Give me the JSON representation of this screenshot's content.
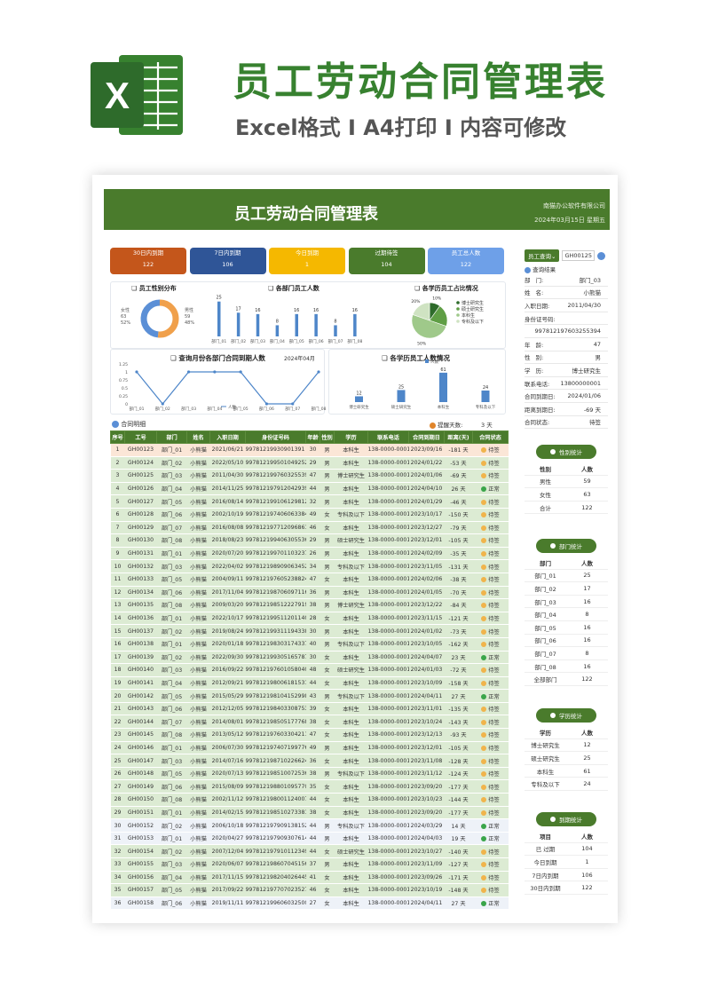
{
  "hero": {
    "logo_letter": "X",
    "title": "员工劳动合同管理表",
    "subtitle": "Excel格式 I A4打印 I 内容可修改"
  },
  "sheet": {
    "title": "员工劳动合同管理表",
    "company": "南猫办公软件有限公司",
    "date": "2024年03月15日  星期五",
    "kpis": [
      {
        "label": "30日内到期",
        "value": "122",
        "color": "#c4561b"
      },
      {
        "label": "7日内到期",
        "value": "106",
        "color": "#2f5597"
      },
      {
        "label": "今日到期",
        "value": "1",
        "color": "#f5b800"
      },
      {
        "label": "过期待签",
        "value": "104",
        "color": "#4a7b2c"
      },
      {
        "label": "员工总人数",
        "value": "122",
        "color": "#6ea0e8"
      }
    ],
    "gender_panel": {
      "title": "员工性别分布",
      "female_label": "女性",
      "female_count": "63",
      "female_pct": "52%",
      "male_label": "男性",
      "male_count": "59",
      "male_pct": "48%"
    },
    "dept_panel": {
      "title": "各部门员工人数"
    },
    "edu_panel": {
      "title": "各学历员工占比情况"
    },
    "month_panel": {
      "title": "查询月份各部门合同到期人数",
      "month": "2024年04月",
      "legend": "人数"
    },
    "edu_count_panel": {
      "title": "各学历员工人数情况",
      "legend": "人数"
    },
    "table_title": "合同明细",
    "reminder_label": "提醒天数:",
    "reminder_value": "3 天",
    "columns": [
      "序号",
      "工号",
      "部门",
      "姓名",
      "入职日期",
      "身份证号码",
      "年龄",
      "性别",
      "学历",
      "联系电话",
      "合同到期日",
      "距离(天)",
      "合同状态"
    ],
    "rows": [
      [
        "1",
        "GH00123",
        "部门_01",
        "小熊猫",
        "2021/06/21",
        "99781219930901391 4",
        "30",
        "男",
        "本科生",
        "138-0000-0001",
        "2023/09/16",
        "-181 天",
        "待签",
        "o"
      ],
      [
        "2",
        "GH00124",
        "部门_02",
        "小熊猫",
        "2022/05/10",
        "997812199501049252",
        "29",
        "男",
        "本科生",
        "138-0000-0001",
        "2024/01/22",
        "-53 天",
        "待签",
        "g"
      ],
      [
        "3",
        "GH00125",
        "部门_03",
        "小熊猫",
        "2011/04/30",
        "997812199760325539 4",
        "47",
        "男",
        "博士研究生",
        "138-0000-0001",
        "2024/01/06",
        "-69 天",
        "待签",
        "g"
      ],
      [
        "4",
        "GH00126",
        "部门_04",
        "小熊猫",
        "2014/11/25",
        "997812197912042939",
        "44",
        "男",
        "本科生",
        "138-0000-0001",
        "2024/04/10",
        "26 天",
        "正常",
        "g"
      ],
      [
        "5",
        "GH00127",
        "部门_05",
        "小熊猫",
        "2016/08/14",
        "997812199106129812",
        "32",
        "男",
        "本科生",
        "138-0000-0001",
        "2024/01/29",
        "-46 天",
        "待签",
        "g"
      ],
      [
        "6",
        "GH00128",
        "部门_06",
        "小熊猫",
        "2002/10/19",
        "997812197406063384",
        "49",
        "女",
        "专科及以下",
        "138-0000-0001",
        "2023/10/17",
        "-150 天",
        "待签",
        "g"
      ],
      [
        "7",
        "GH00129",
        "部门_07",
        "小熊猫",
        "2016/08/08",
        "997812197712096861",
        "46",
        "女",
        "本科生",
        "138-0000-0001",
        "2023/12/27",
        "-79 天",
        "待签",
        "g"
      ],
      [
        "8",
        "GH00130",
        "部门_08",
        "小熊猫",
        "2018/08/23",
        "997812199406305536",
        "29",
        "男",
        "硕士研究生",
        "138-0000-0001",
        "2023/12/01",
        "-105 天",
        "待签",
        "g"
      ],
      [
        "9",
        "GH00131",
        "部门_01",
        "小熊猫",
        "2020/07/20",
        "997812199701103237",
        "26",
        "男",
        "本科生",
        "138-0000-0001",
        "2024/02/09",
        "-35 天",
        "待签",
        "g"
      ],
      [
        "10",
        "GH00132",
        "部门_03",
        "小熊猫",
        "2022/04/02",
        "997812198909063452",
        "34",
        "男",
        "专科及以下",
        "138-0000-0001",
        "2023/11/05",
        "-131 天",
        "待签",
        "g"
      ],
      [
        "11",
        "GH00133",
        "部门_05",
        "小熊猫",
        "2004/09/11",
        "997812197605238824",
        "47",
        "女",
        "本科生",
        "138-0000-0001",
        "2024/02/06",
        "-38 天",
        "待签",
        "g"
      ],
      [
        "12",
        "GH00134",
        "部门_06",
        "小熊猫",
        "2017/11/04",
        "997812198706097116",
        "36",
        "男",
        "本科生",
        "138-0000-0001",
        "2024/01/05",
        "-70 天",
        "待签",
        "g"
      ],
      [
        "13",
        "GH00135",
        "部门_08",
        "小熊猫",
        "2009/03/20",
        "997812198512227919",
        "38",
        "男",
        "博士研究生",
        "138-0000-0001",
        "2023/12/22",
        "-84 天",
        "待签",
        "g"
      ],
      [
        "14",
        "GH00136",
        "部门_01",
        "小熊猫",
        "2022/10/17",
        "997812199511201140",
        "28",
        "女",
        "本科生",
        "138-0000-0001",
        "2023/11/15",
        "-121 天",
        "待签",
        "g"
      ],
      [
        "15",
        "GH00137",
        "部门_02",
        "小熊猫",
        "2019/08/24",
        "997812199311194338",
        "30",
        "男",
        "本科生",
        "138-0000-0001",
        "2024/01/02",
        "-73 天",
        "待签",
        "g"
      ],
      [
        "16",
        "GH00138",
        "部门_01",
        "小熊猫",
        "2020/01/18",
        "997812198303174337",
        "40",
        "男",
        "专科及以下",
        "138-0000-0001",
        "2023/10/05",
        "-162 天",
        "待签",
        "g"
      ],
      [
        "17",
        "GH00139",
        "部门_02",
        "小熊猫",
        "2022/09/30",
        "997812199305165787",
        "30",
        "女",
        "本科生",
        "138-0000-0001",
        "2024/04/07",
        "23 天",
        "正常",
        "g"
      ],
      [
        "18",
        "GH00140",
        "部门_03",
        "小熊猫",
        "2016/09/22",
        "997812197601058040",
        "48",
        "女",
        "硕士研究生",
        "138-0000-0001",
        "2024/01/03",
        "-72 天",
        "待签",
        "g"
      ],
      [
        "19",
        "GH00141",
        "部门_04",
        "小熊猫",
        "2012/09/21",
        "997812198006181531",
        "44",
        "女",
        "本科生",
        "138-0000-0001",
        "2023/10/09",
        "-158 天",
        "待签",
        "g"
      ],
      [
        "20",
        "GH00142",
        "部门_05",
        "小熊猫",
        "2015/05/29",
        "997812198104152998",
        "43",
        "男",
        "专科及以下",
        "138-0000-0001",
        "2024/04/11",
        "27 天",
        "正常",
        "g"
      ],
      [
        "21",
        "GH00143",
        "部门_06",
        "小熊猫",
        "2012/12/05",
        "997812198403308753",
        "39",
        "女",
        "本科生",
        "138-0000-0001",
        "2023/11/01",
        "-135 天",
        "待签",
        "g"
      ],
      [
        "22",
        "GH00144",
        "部门_07",
        "小熊猫",
        "2014/08/01",
        "997812198505177768",
        "38",
        "女",
        "本科生",
        "138-0000-0001",
        "2023/10/24",
        "-143 天",
        "待签",
        "g"
      ],
      [
        "23",
        "GH00145",
        "部门_08",
        "小熊猫",
        "2013/05/12",
        "997812197603304211",
        "47",
        "女",
        "本科生",
        "138-0000-0001",
        "2023/12/13",
        "-93 天",
        "待签",
        "g"
      ],
      [
        "24",
        "GH00146",
        "部门_01",
        "小熊猫",
        "2006/07/30",
        "997812197407199776",
        "49",
        "男",
        "本科生",
        "138-0000-0001",
        "2023/12/01",
        "-105 天",
        "待签",
        "g"
      ],
      [
        "25",
        "GH00147",
        "部门_03",
        "小熊猫",
        "2014/07/16",
        "997812198710226624",
        "36",
        "女",
        "本科生",
        "138-0000-0001",
        "2023/11/08",
        "-128 天",
        "待签",
        "g"
      ],
      [
        "26",
        "GH00148",
        "部门_05",
        "小熊猫",
        "2020/07/13",
        "997812198510072536",
        "38",
        "男",
        "专科及以下",
        "138-0000-0001",
        "2023/11/12",
        "-124 天",
        "待签",
        "g"
      ],
      [
        "27",
        "GH00149",
        "部门_06",
        "小熊猫",
        "2015/08/09",
        "997812198801095770",
        "35",
        "女",
        "本科生",
        "138-0000-0001",
        "2023/09/20",
        "-177 天",
        "待签",
        "g"
      ],
      [
        "28",
        "GH00150",
        "部门_08",
        "小熊猫",
        "2002/11/12",
        "997812198001124007",
        "44",
        "女",
        "本科生",
        "138-0000-0001",
        "2023/10/23",
        "-144 天",
        "待签",
        "g"
      ],
      [
        "29",
        "GH00151",
        "部门_01",
        "小熊猫",
        "2014/02/15",
        "997812198510273381",
        "38",
        "女",
        "本科生",
        "138-0000-0001",
        "2023/09/20",
        "-177 天",
        "待签",
        "g"
      ],
      [
        "30",
        "GH00152",
        "部门_02",
        "小熊猫",
        "2006/10/18",
        "997812197909138152",
        "44",
        "男",
        "专科及以下",
        "138-0000-0001",
        "2024/03/29",
        "14 天",
        "正常",
        "w"
      ],
      [
        "31",
        "GH00153",
        "部门_01",
        "小熊猫",
        "2020/04/27",
        "997812197909307614",
        "44",
        "男",
        "本科生",
        "138-0000-0001",
        "2024/04/03",
        "19 天",
        "正常",
        "w"
      ],
      [
        "32",
        "GH00154",
        "部门_02",
        "小熊猫",
        "2007/12/04",
        "997812197910112349",
        "44",
        "女",
        "硕士研究生",
        "138-0000-0001",
        "2023/10/27",
        "-140 天",
        "待签",
        "g"
      ],
      [
        "33",
        "GH00155",
        "部门_03",
        "小熊猫",
        "2020/06/07",
        "997812198607045156",
        "37",
        "男",
        "本科生",
        "138-0000-0001",
        "2023/11/09",
        "-127 天",
        "待签",
        "g"
      ],
      [
        "34",
        "GH00156",
        "部门_04",
        "小熊猫",
        "2017/11/15",
        "997812198204026445",
        "41",
        "女",
        "本科生",
        "138-0000-0001",
        "2023/09/26",
        "-171 天",
        "待签",
        "g"
      ],
      [
        "35",
        "GH00157",
        "部门_05",
        "小熊猫",
        "2017/09/22",
        "997812197707023527",
        "46",
        "女",
        "本科生",
        "138-0000-0001",
        "2023/10/19",
        "-148 天",
        "待签",
        "g"
      ],
      [
        "36",
        "GH00158",
        "部门_06",
        "小熊猫",
        "2019/11/11",
        "997812199606032500",
        "27",
        "女",
        "本科生",
        "138-0000-0001",
        "2024/04/11",
        "27 天",
        "正常",
        "w"
      ]
    ],
    "query": {
      "label": "员工查询",
      "id": "GH00125",
      "result": "查询结果",
      "fields": [
        [
          "部",
          "门:",
          "部门_03"
        ],
        [
          "姓",
          "名:",
          "小熊猫"
        ],
        [
          "入职日期:",
          "",
          "2011/04/30"
        ],
        [
          "身份证号码:",
          "",
          ""
        ],
        [
          "",
          "",
          "997812197603255394"
        ],
        [
          "年",
          "龄:",
          "47"
        ],
        [
          "性",
          "别:",
          "男"
        ],
        [
          "学",
          "历:",
          "博士研究生"
        ],
        [
          "联系电话:",
          "",
          "13800000001"
        ],
        [
          "合同到期日:",
          "",
          "2024/01/06"
        ],
        [
          "距离到期日:",
          "",
          "-69 天"
        ],
        [
          "合同状态:",
          "",
          "待签"
        ]
      ]
    },
    "gender_stats": {
      "title": "性别统计",
      "head": [
        "性别",
        "人数"
      ],
      "rows": [
        [
          "男性",
          "59"
        ],
        [
          "女性",
          "63"
        ],
        [
          "合计",
          "122"
        ]
      ]
    },
    "dept_stats": {
      "title": "部门统计",
      "head": [
        "部门",
        "人数"
      ],
      "rows": [
        [
          "部门_01",
          "25"
        ],
        [
          "部门_02",
          "17"
        ],
        [
          "部门_03",
          "16"
        ],
        [
          "部门_04",
          "8"
        ],
        [
          "部门_05",
          "16"
        ],
        [
          "部门_06",
          "16"
        ],
        [
          "部门_07",
          "8"
        ],
        [
          "部门_08",
          "16"
        ],
        [
          "全部部门",
          "122"
        ]
      ]
    },
    "edu_stats": {
      "title": "学历统计",
      "head": [
        "学历",
        "人数"
      ],
      "rows": [
        [
          "博士研究生",
          "12"
        ],
        [
          "硕士研究生",
          "25"
        ],
        [
          "本科生",
          "61"
        ],
        [
          "专科及以下",
          "24"
        ]
      ]
    },
    "due_stats": {
      "title": "到期统计",
      "head": [
        "项目",
        "人数"
      ],
      "rows": [
        [
          "已 过期",
          "104"
        ],
        [
          "今日到期",
          "1"
        ],
        [
          "7日内到期",
          "106"
        ],
        [
          "30日内到期",
          "122"
        ]
      ]
    }
  },
  "chart_data": [
    {
      "type": "pie",
      "title": "员工性别分布",
      "categories": [
        "女性",
        "男性"
      ],
      "values": [
        63,
        59
      ],
      "colors": [
        "#f0a04b",
        "#5b8fd6"
      ]
    },
    {
      "type": "bar",
      "title": "各部门员工人数",
      "categories": [
        "部门_01",
        "部门_02",
        "部门_03",
        "部门_04",
        "部门_05",
        "部门_06",
        "部门_07",
        "部门_08"
      ],
      "values": [
        25,
        17,
        16,
        8,
        16,
        16,
        8,
        16
      ],
      "color": "#4e86c9"
    },
    {
      "type": "pie",
      "title": "各学历员工占比情况",
      "categories": [
        "博士研究生",
        "硕士研究生",
        "本科生",
        "专科及以下"
      ],
      "values": [
        12,
        25,
        61,
        24
      ],
      "labels": [
        "10%",
        "",
        "50%",
        "20%"
      ],
      "colors": [
        "#2e6b2b",
        "#5f9e45",
        "#9fc98a",
        "#cfe3c2"
      ]
    },
    {
      "type": "line",
      "title": "查询月份各部门合同到期人数",
      "categories": [
        "部门_01",
        "部门_02",
        "部门_03",
        "部门_04",
        "部门_05",
        "部门_06",
        "部门_07",
        "部门_08"
      ],
      "values": [
        1,
        0,
        1,
        1,
        1,
        0,
        0,
        1
      ],
      "yticks": [
        "0",
        "0.25",
        "0.5",
        "0.75",
        "1",
        "1.25"
      ],
      "ylim": [
        0,
        1.25
      ],
      "xtick_labels": [
        "部门_01",
        "部门_02",
        "部门_03",
        "部门_04",
        "部门_05",
        "部门_06",
        "部门_07",
        "部门_08"
      ]
    },
    {
      "type": "bar",
      "title": "各学历员工人数情况",
      "categories": [
        "博士研究生",
        "硕士研究生",
        "本科生",
        "专科及以下"
      ],
      "values": [
        12,
        25,
        61,
        24
      ],
      "color": "#4e86c9"
    }
  ]
}
